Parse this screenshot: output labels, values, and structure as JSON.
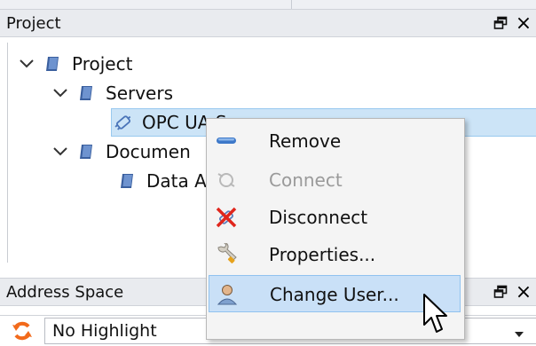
{
  "project_panel": {
    "title": "Project",
    "float_icon": "float-window-icon",
    "close_label": "×"
  },
  "tree": {
    "items": [
      {
        "label": "Project",
        "icon": "folder-icon",
        "expanded": true
      },
      {
        "label": "Servers",
        "icon": "folder-icon",
        "expanded": true
      },
      {
        "label": "OPC UA S",
        "icon": "server-plug-icon",
        "selected": true
      },
      {
        "label": "Documen",
        "icon": "folder-icon",
        "expanded": true
      },
      {
        "label": "Data A",
        "icon": "folder-icon"
      }
    ]
  },
  "context_menu": {
    "items": [
      {
        "label": "Remove",
        "icon": "minus-icon",
        "disabled": false
      },
      {
        "label": "Connect",
        "icon": "connect-plug-icon",
        "disabled": true
      },
      {
        "label": "Disconnect",
        "icon": "disconnect-icon",
        "disabled": false
      },
      {
        "label": "Properties...",
        "icon": "wrench-icon",
        "disabled": false
      },
      {
        "label": "Change User...",
        "icon": "user-icon",
        "disabled": false,
        "hovered": true
      }
    ]
  },
  "address_space_panel": {
    "title": "Address Space",
    "float_icon": "float-window-icon",
    "close_label": "×"
  },
  "highlight_dropdown": {
    "value": "No Highlight",
    "icon": "refresh-icon"
  },
  "colors": {
    "selection": "#cce4f7",
    "menu_hover": "#c9e0f7",
    "refresh_orange": "#f26a1b"
  }
}
